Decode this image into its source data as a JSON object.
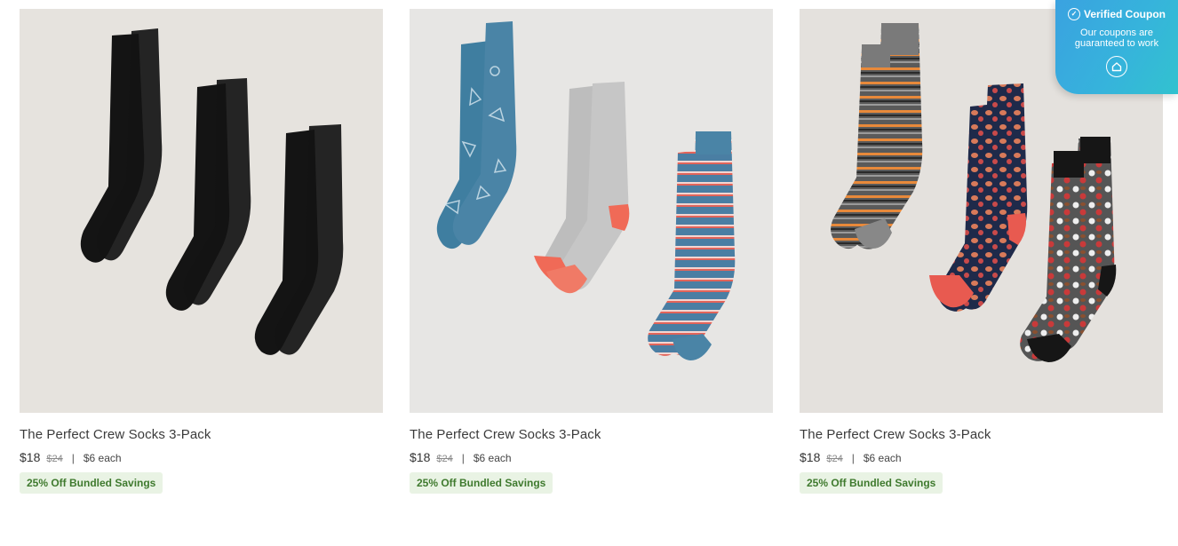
{
  "products": [
    {
      "title": "The Perfect Crew Socks 3-Pack",
      "price": "$18",
      "original_price": "$24",
      "separator": "|",
      "unit_price": "$6 each",
      "badge": "25% Off Bundled Savings",
      "image": "three-black-crew-socks"
    },
    {
      "title": "The Perfect Crew Socks 3-Pack",
      "price": "$18",
      "original_price": "$24",
      "separator": "|",
      "unit_price": "$6 each",
      "badge": "25% Off Bundled Savings",
      "image": "blue-pattern-grey-coral-striped-socks"
    },
    {
      "title": "The Perfect Crew Socks 3-Pack",
      "price": "$18",
      "original_price": "$24",
      "separator": "|",
      "unit_price": "$6 each",
      "badge": "25% Off Bundled Savings",
      "image": "striped-navy-sports-grey-sports-socks"
    }
  ],
  "coupon": {
    "title": "Verified Coupon",
    "subtitle": "Our coupons are guaranteed to work",
    "icon": "home-icon"
  },
  "colors": {
    "badge_bg": "#e9f3e4",
    "badge_text": "#3f7a2e",
    "coupon_gradient_start": "#3aa2e0",
    "coupon_gradient_end": "#32c2cf"
  }
}
